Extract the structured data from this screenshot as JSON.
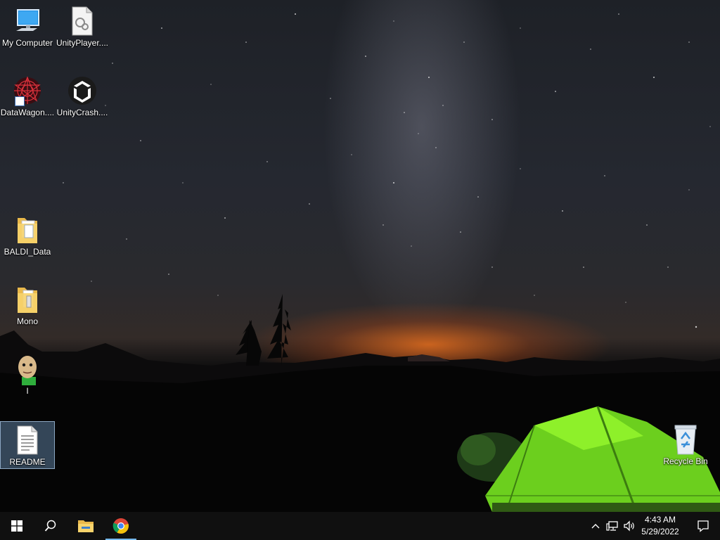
{
  "desktop": {
    "wallpaper": "night sky milky way with green tent",
    "icons": [
      {
        "label": "My Computer",
        "icon": "computer-icon"
      },
      {
        "label": "UnityPlayer....",
        "icon": "dll-file-icon"
      },
      {
        "label": "DataWagon....",
        "icon": "datawagon-icon"
      },
      {
        "label": "UnityCrash....",
        "icon": "unity-icon"
      },
      {
        "label": "BALDI_Data",
        "icon": "folder-icon"
      },
      {
        "label": "Mono",
        "icon": "folder-icon"
      },
      {
        "label": "I",
        "icon": "baldi-icon"
      },
      {
        "label": "README",
        "icon": "text-document-icon",
        "selected": true
      },
      {
        "label": "Recycle Bin",
        "icon": "recycle-bin-icon"
      }
    ]
  },
  "taskbar": {
    "start": "start-icon",
    "search": "search-icon",
    "pinned": [
      "file-explorer-icon",
      "chrome-icon"
    ],
    "active_app": "chrome-icon",
    "tray": [
      "show-hidden-icons",
      "network-icon",
      "volume-icon"
    ],
    "clock": {
      "time": "4:43 AM",
      "date": "5/29/2022"
    },
    "notifications": "action-center-icon",
    "accent_color": "#76b9ed"
  }
}
